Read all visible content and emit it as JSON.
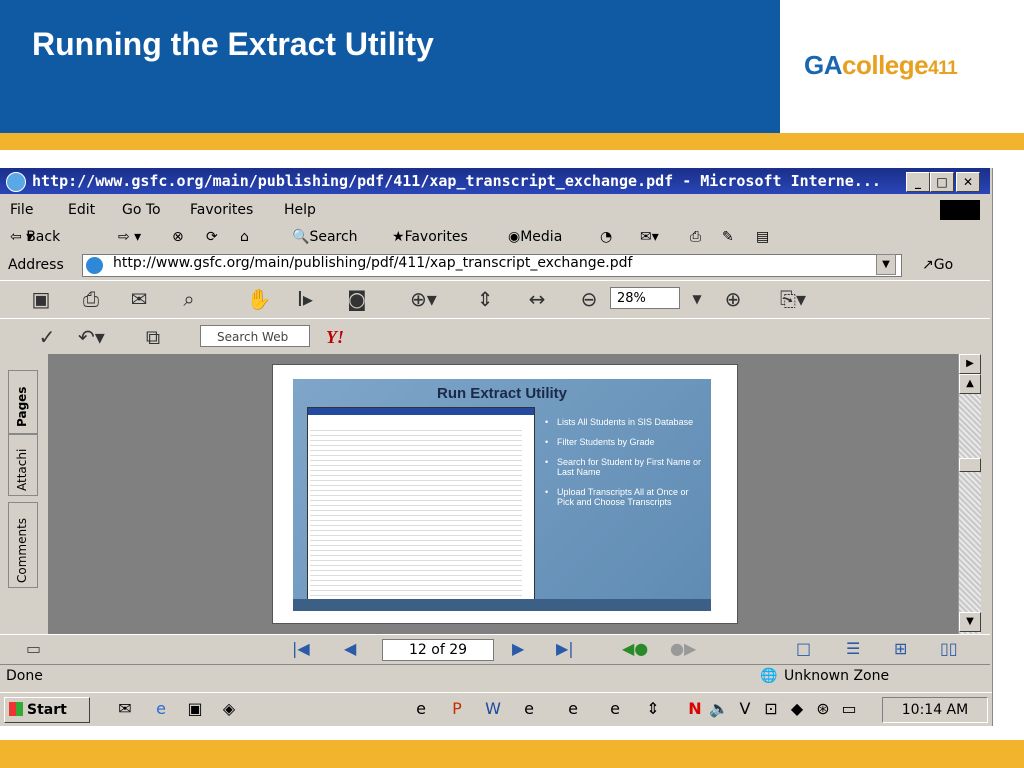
{
  "slide": {
    "title": "Running the Extract Utility",
    "logo_ga": "GA",
    "logo_college": "college",
    "logo_num": "411"
  },
  "browser": {
    "title": "http://www.gsfc.org/main/publishing/pdf/411/xap_transcript_exchange.pdf - Microsoft Interne...",
    "menu": [
      "File",
      "Edit",
      "Go To",
      "Favorites",
      "Help"
    ],
    "toolbar": {
      "back": "Back",
      "search": "Search",
      "favorites": "Favorites",
      "media": "Media"
    },
    "address_label": "Address",
    "address_value": "http://www.gsfc.org/main/publishing/pdf/411/xap_transcript_exchange.pdf",
    "go": "Go",
    "zoom": "28%",
    "search_web_placeholder": "Search Web",
    "yahoo": "Y!",
    "side_tabs": {
      "pages": "Pages",
      "attachments": "Attachi",
      "comments": "Comments"
    },
    "page_indicator": "12 of 29",
    "status_text": "Done",
    "zone": "Unknown Zone"
  },
  "inner_slide": {
    "title": "Run Extract Utility",
    "bullets": [
      "Lists All Students in SIS Database",
      "Filter Students by Grade",
      "Search for Student by First Name or Last Name",
      "Upload Transcripts All at Once or Pick and Choose Transcripts"
    ]
  },
  "taskbar": {
    "start": "Start",
    "clock": "10:14 AM"
  },
  "colors": {
    "header_blue": "#0f5aa3",
    "stripe_gold": "#f2b42d"
  }
}
